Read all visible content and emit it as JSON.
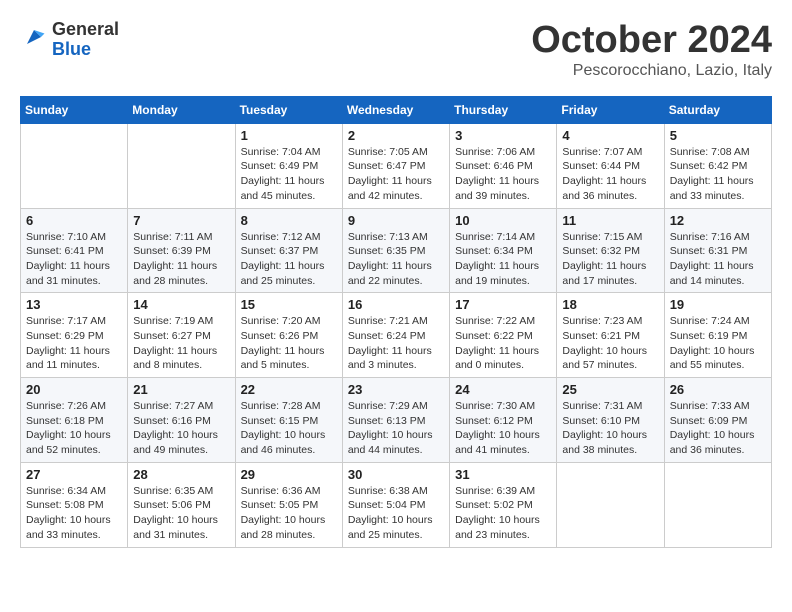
{
  "logo": {
    "general": "General",
    "blue": "Blue"
  },
  "title": "October 2024",
  "location": "Pescorocchiano, Lazio, Italy",
  "days_header": [
    "Sunday",
    "Monday",
    "Tuesday",
    "Wednesday",
    "Thursday",
    "Friday",
    "Saturday"
  ],
  "weeks": [
    [
      {
        "day": "",
        "info": ""
      },
      {
        "day": "",
        "info": ""
      },
      {
        "day": "1",
        "info": "Sunrise: 7:04 AM\nSunset: 6:49 PM\nDaylight: 11 hours and 45 minutes."
      },
      {
        "day": "2",
        "info": "Sunrise: 7:05 AM\nSunset: 6:47 PM\nDaylight: 11 hours and 42 minutes."
      },
      {
        "day": "3",
        "info": "Sunrise: 7:06 AM\nSunset: 6:46 PM\nDaylight: 11 hours and 39 minutes."
      },
      {
        "day": "4",
        "info": "Sunrise: 7:07 AM\nSunset: 6:44 PM\nDaylight: 11 hours and 36 minutes."
      },
      {
        "day": "5",
        "info": "Sunrise: 7:08 AM\nSunset: 6:42 PM\nDaylight: 11 hours and 33 minutes."
      }
    ],
    [
      {
        "day": "6",
        "info": "Sunrise: 7:10 AM\nSunset: 6:41 PM\nDaylight: 11 hours and 31 minutes."
      },
      {
        "day": "7",
        "info": "Sunrise: 7:11 AM\nSunset: 6:39 PM\nDaylight: 11 hours and 28 minutes."
      },
      {
        "day": "8",
        "info": "Sunrise: 7:12 AM\nSunset: 6:37 PM\nDaylight: 11 hours and 25 minutes."
      },
      {
        "day": "9",
        "info": "Sunrise: 7:13 AM\nSunset: 6:35 PM\nDaylight: 11 hours and 22 minutes."
      },
      {
        "day": "10",
        "info": "Sunrise: 7:14 AM\nSunset: 6:34 PM\nDaylight: 11 hours and 19 minutes."
      },
      {
        "day": "11",
        "info": "Sunrise: 7:15 AM\nSunset: 6:32 PM\nDaylight: 11 hours and 17 minutes."
      },
      {
        "day": "12",
        "info": "Sunrise: 7:16 AM\nSunset: 6:31 PM\nDaylight: 11 hours and 14 minutes."
      }
    ],
    [
      {
        "day": "13",
        "info": "Sunrise: 7:17 AM\nSunset: 6:29 PM\nDaylight: 11 hours and 11 minutes."
      },
      {
        "day": "14",
        "info": "Sunrise: 7:19 AM\nSunset: 6:27 PM\nDaylight: 11 hours and 8 minutes."
      },
      {
        "day": "15",
        "info": "Sunrise: 7:20 AM\nSunset: 6:26 PM\nDaylight: 11 hours and 5 minutes."
      },
      {
        "day": "16",
        "info": "Sunrise: 7:21 AM\nSunset: 6:24 PM\nDaylight: 11 hours and 3 minutes."
      },
      {
        "day": "17",
        "info": "Sunrise: 7:22 AM\nSunset: 6:22 PM\nDaylight: 11 hours and 0 minutes."
      },
      {
        "day": "18",
        "info": "Sunrise: 7:23 AM\nSunset: 6:21 PM\nDaylight: 10 hours and 57 minutes."
      },
      {
        "day": "19",
        "info": "Sunrise: 7:24 AM\nSunset: 6:19 PM\nDaylight: 10 hours and 55 minutes."
      }
    ],
    [
      {
        "day": "20",
        "info": "Sunrise: 7:26 AM\nSunset: 6:18 PM\nDaylight: 10 hours and 52 minutes."
      },
      {
        "day": "21",
        "info": "Sunrise: 7:27 AM\nSunset: 6:16 PM\nDaylight: 10 hours and 49 minutes."
      },
      {
        "day": "22",
        "info": "Sunrise: 7:28 AM\nSunset: 6:15 PM\nDaylight: 10 hours and 46 minutes."
      },
      {
        "day": "23",
        "info": "Sunrise: 7:29 AM\nSunset: 6:13 PM\nDaylight: 10 hours and 44 minutes."
      },
      {
        "day": "24",
        "info": "Sunrise: 7:30 AM\nSunset: 6:12 PM\nDaylight: 10 hours and 41 minutes."
      },
      {
        "day": "25",
        "info": "Sunrise: 7:31 AM\nSunset: 6:10 PM\nDaylight: 10 hours and 38 minutes."
      },
      {
        "day": "26",
        "info": "Sunrise: 7:33 AM\nSunset: 6:09 PM\nDaylight: 10 hours and 36 minutes."
      }
    ],
    [
      {
        "day": "27",
        "info": "Sunrise: 6:34 AM\nSunset: 5:08 PM\nDaylight: 10 hours and 33 minutes."
      },
      {
        "day": "28",
        "info": "Sunrise: 6:35 AM\nSunset: 5:06 PM\nDaylight: 10 hours and 31 minutes."
      },
      {
        "day": "29",
        "info": "Sunrise: 6:36 AM\nSunset: 5:05 PM\nDaylight: 10 hours and 28 minutes."
      },
      {
        "day": "30",
        "info": "Sunrise: 6:38 AM\nSunset: 5:04 PM\nDaylight: 10 hours and 25 minutes."
      },
      {
        "day": "31",
        "info": "Sunrise: 6:39 AM\nSunset: 5:02 PM\nDaylight: 10 hours and 23 minutes."
      },
      {
        "day": "",
        "info": ""
      },
      {
        "day": "",
        "info": ""
      }
    ]
  ]
}
